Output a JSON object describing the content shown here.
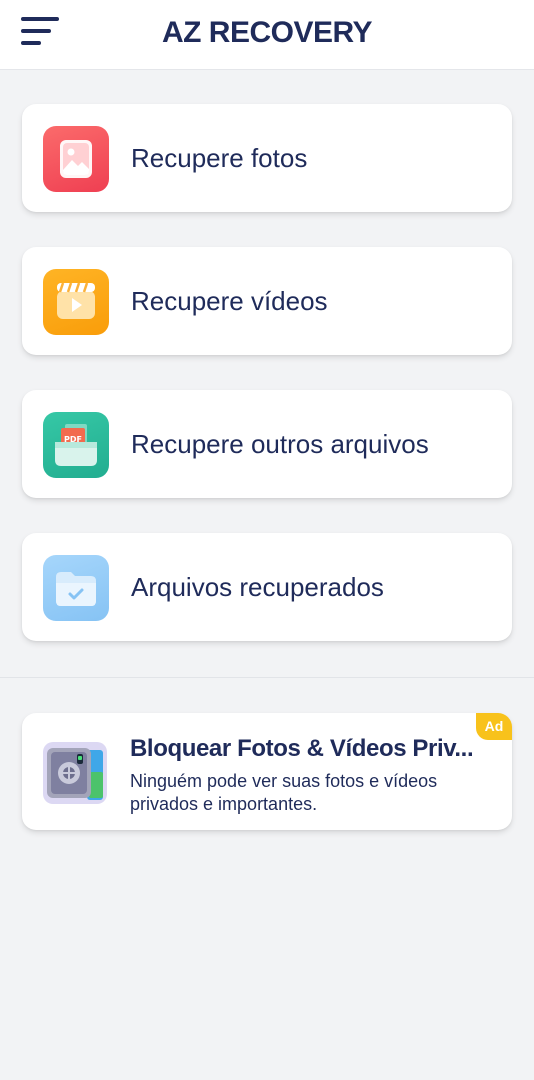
{
  "header": {
    "title": "AZ RECOVERY",
    "menu_icon": "hamburger-menu-icon"
  },
  "menu_items": [
    {
      "label": "Recupere fotos",
      "icon": "photo-icon",
      "color": "#f4545a"
    },
    {
      "label": "Recupere vídeos",
      "icon": "video-icon",
      "color": "#fda417"
    },
    {
      "label": "Recupere outros arquivos",
      "icon": "pdf-files-icon",
      "color": "#2cbd9e"
    },
    {
      "label": "Arquivos recuperados",
      "icon": "folder-check-icon",
      "color": "#93cbf8"
    }
  ],
  "ad": {
    "badge": "Ad",
    "title": "Bloquear Fotos & Vídeos Priv...",
    "description": "Ninguém pode ver suas fotos e vídeos privados e importantes.",
    "icon": "safe-vault-icon"
  },
  "colors": {
    "primary_text": "#1f2b5a",
    "background": "#f2f3f5",
    "ad_badge": "#f8c21b"
  }
}
